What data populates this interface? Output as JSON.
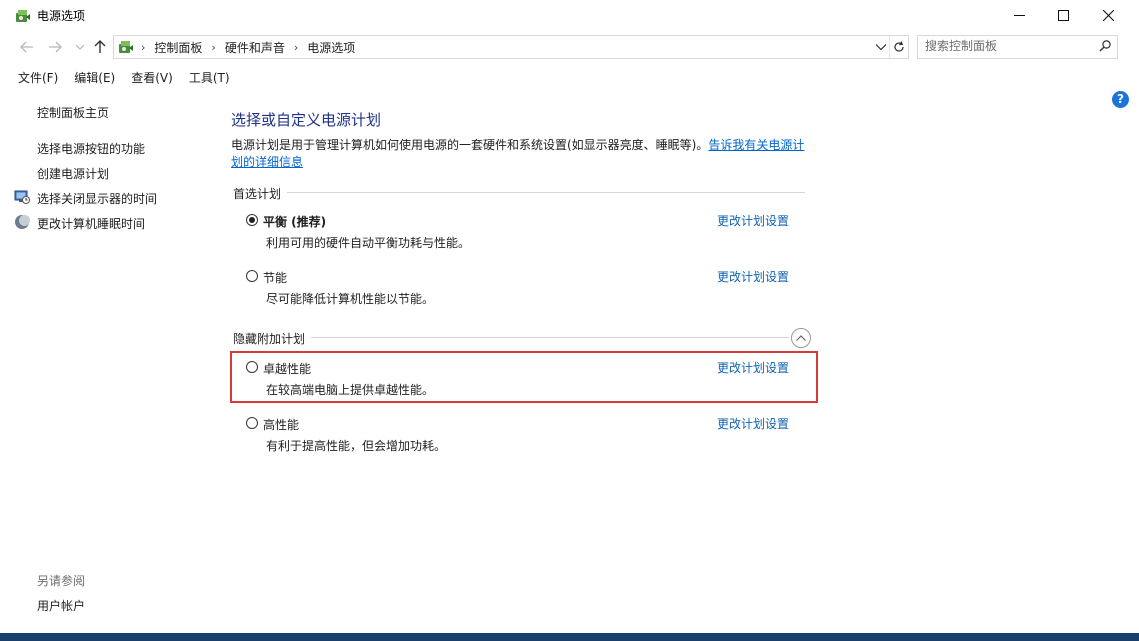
{
  "window": {
    "title": "电源选项"
  },
  "address_bar": {
    "breadcrumbs": [
      "控制面板",
      "硬件和声音",
      "电源选项"
    ]
  },
  "search": {
    "placeholder": "搜索控制面板"
  },
  "menu": [
    "文件(F)",
    "编辑(E)",
    "查看(V)",
    "工具(T)"
  ],
  "sidebar": {
    "home": "控制面板主页",
    "links": [
      {
        "label": "选择电源按钮的功能",
        "icon": "none"
      },
      {
        "label": "创建电源计划",
        "icon": "none"
      },
      {
        "label": "选择关闭显示器的时间",
        "icon": "monitor-clock-icon"
      },
      {
        "label": "更改计算机睡眠时间",
        "icon": "moon-icon"
      }
    ],
    "see_also_title": "另请参阅",
    "see_also_links": [
      "用户帐户"
    ]
  },
  "main": {
    "title": "选择或自定义电源计划",
    "description": "电源计划是用于管理计算机如何使用电源的一套硬件和系统设置(如显示器亮度、睡眠等)。",
    "description_link": "告诉我有关电源计划的详细信息",
    "preferred_group": "首选计划",
    "hidden_group": "隐藏附加计划",
    "change_link": "更改计划设置",
    "preferred_plans": [
      {
        "name": "平衡 (推荐)",
        "desc": "利用可用的硬件自动平衡功耗与性能。",
        "selected": true
      },
      {
        "name": "节能",
        "desc": "尽可能降低计算机性能以节能。",
        "selected": false
      }
    ],
    "hidden_plans": [
      {
        "name": "卓越性能",
        "desc": "在较高端电脑上提供卓越性能。",
        "selected": false,
        "highlighted": true
      },
      {
        "name": "高性能",
        "desc": "有利于提高性能，但会增加功耗。",
        "selected": false,
        "highlighted": false
      }
    ]
  },
  "colors": {
    "title_blue": "#1e3287",
    "link_blue": "#0f63b5",
    "highlight_red": "#d8393b",
    "help_blue": "#1c74d8"
  }
}
